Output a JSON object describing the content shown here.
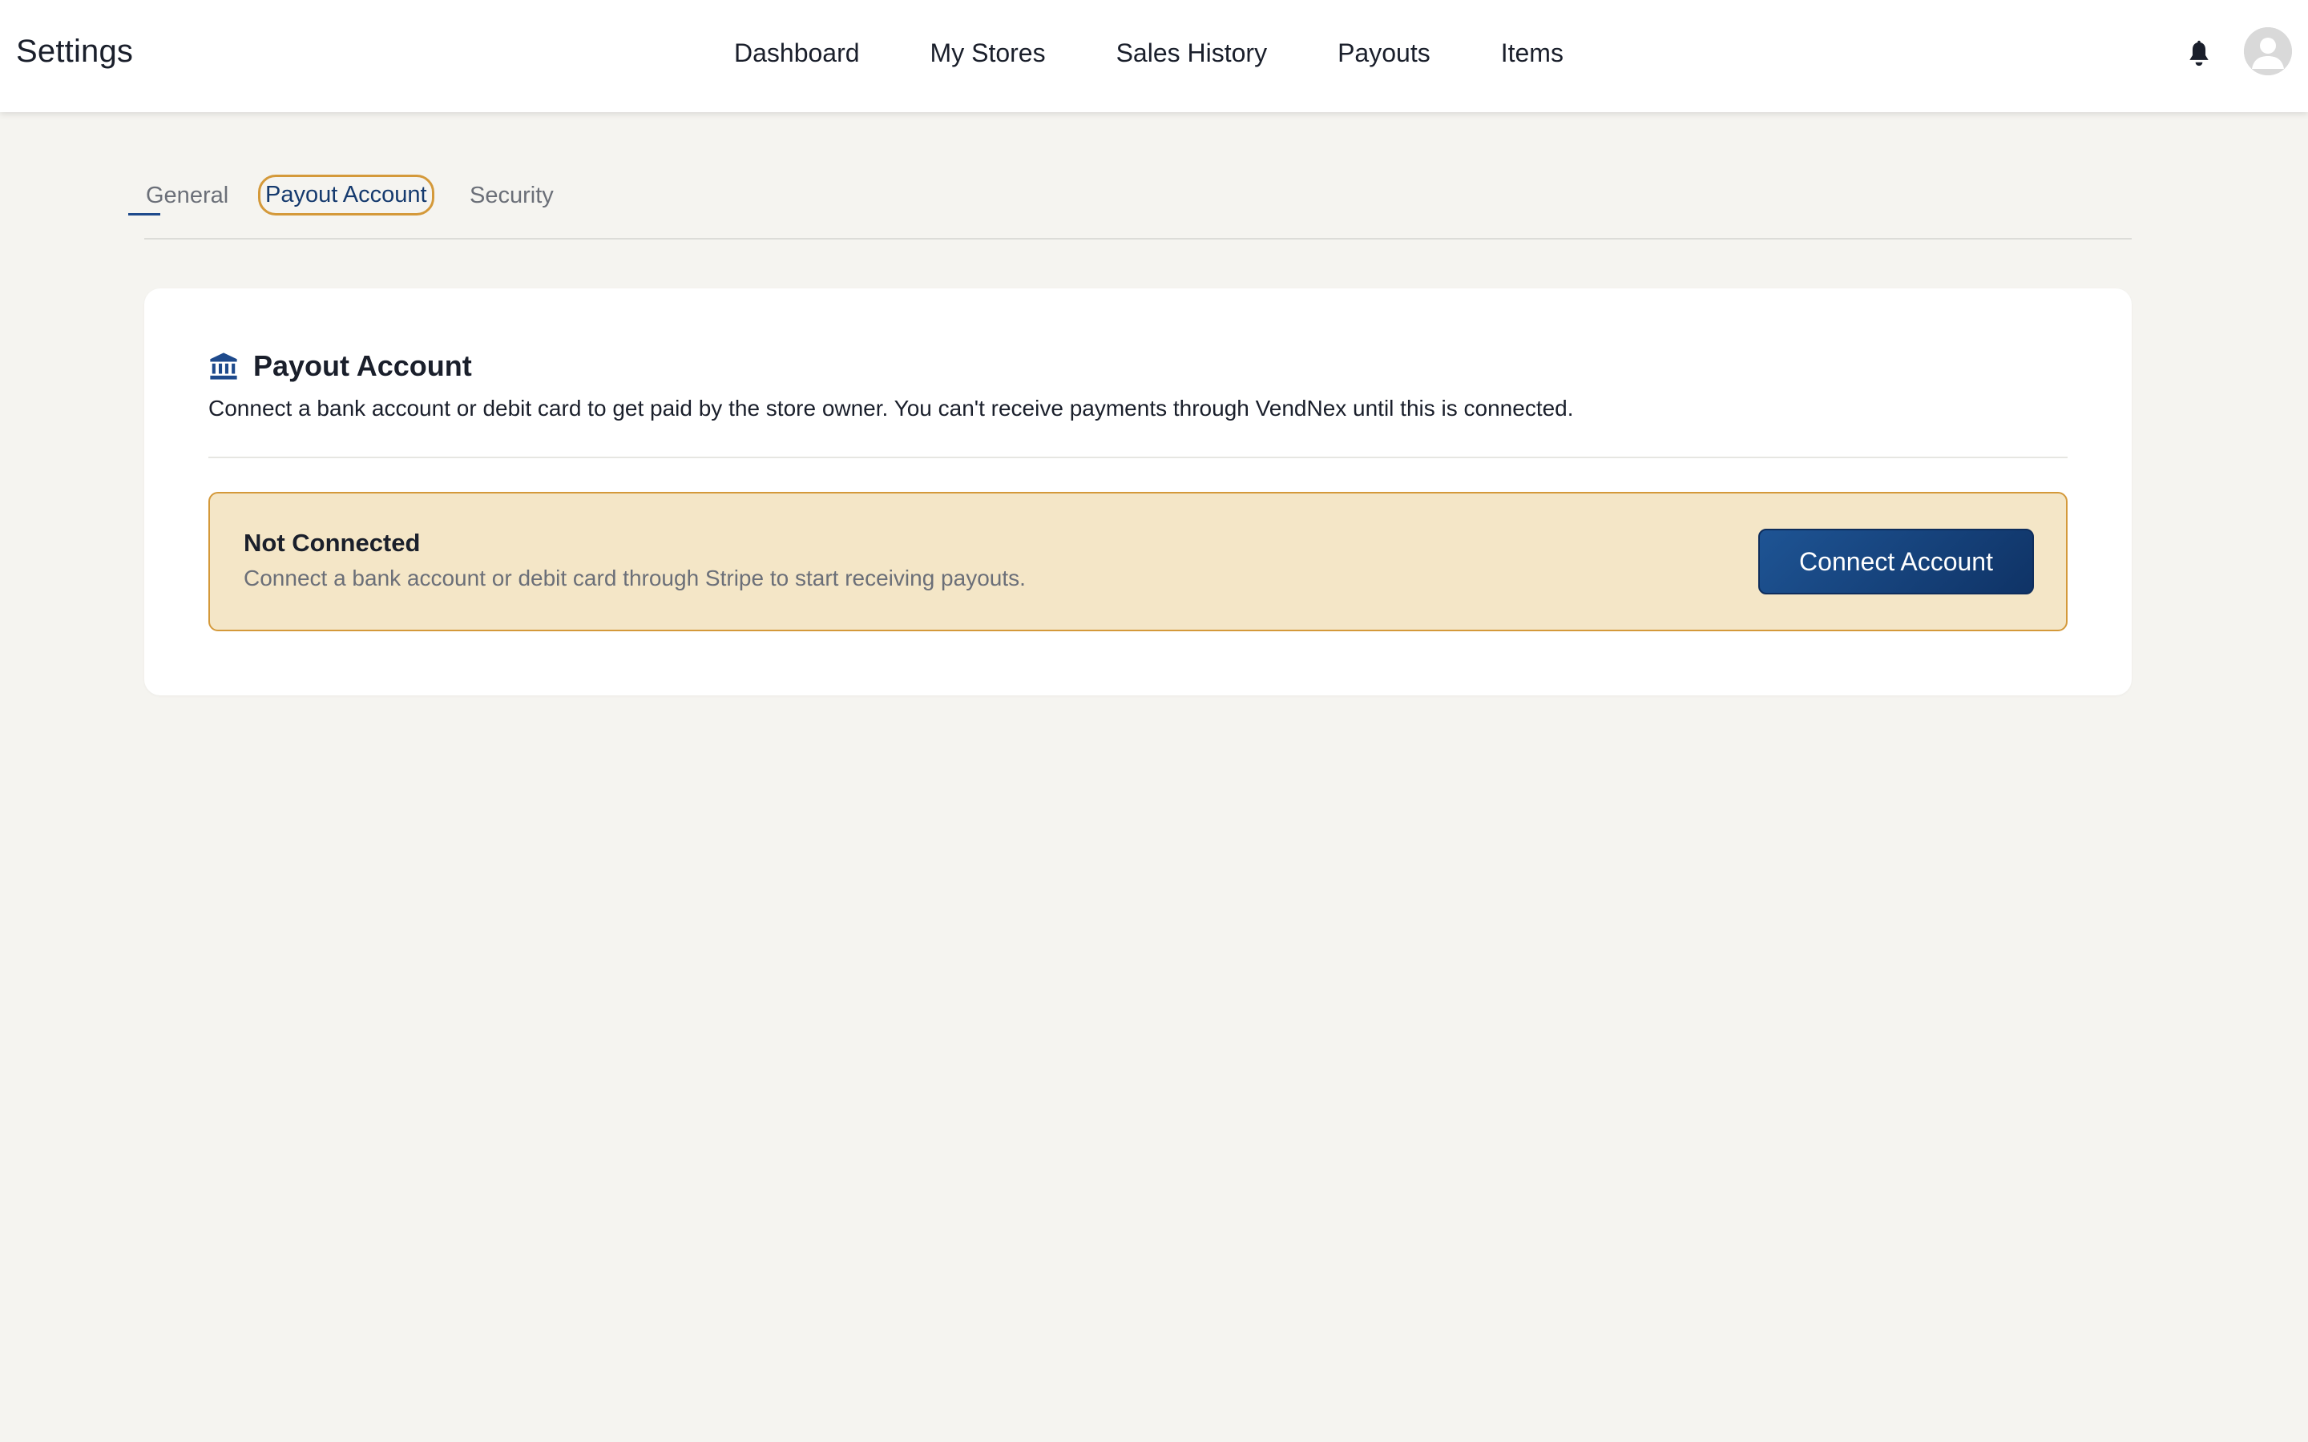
{
  "header": {
    "title": "Settings",
    "nav": [
      {
        "label": "Dashboard"
      },
      {
        "label": "My Stores"
      },
      {
        "label": "Sales History"
      },
      {
        "label": "Payouts"
      },
      {
        "label": "Items"
      }
    ],
    "icons": {
      "notifications": "bell-icon",
      "profile": "avatar"
    }
  },
  "tabs": [
    {
      "label": "General"
    },
    {
      "label": "Payout Account",
      "active": true
    },
    {
      "label": "Security"
    }
  ],
  "card": {
    "icon": "bank-icon",
    "title": "Payout Account",
    "description": "Connect a bank account or debit card to get paid by the store owner. You can't receive payments through VendNex until this is connected.",
    "status": {
      "title": "Not Connected",
      "description": "Connect a bank account or debit card through Stripe to start receiving payouts.",
      "button_label": "Connect Account"
    }
  },
  "colors": {
    "accent": "#1e4a8c",
    "focus_ring": "#d4993a",
    "warning_bg": "#f4e6c7",
    "page_bg": "#f5f4f0"
  }
}
